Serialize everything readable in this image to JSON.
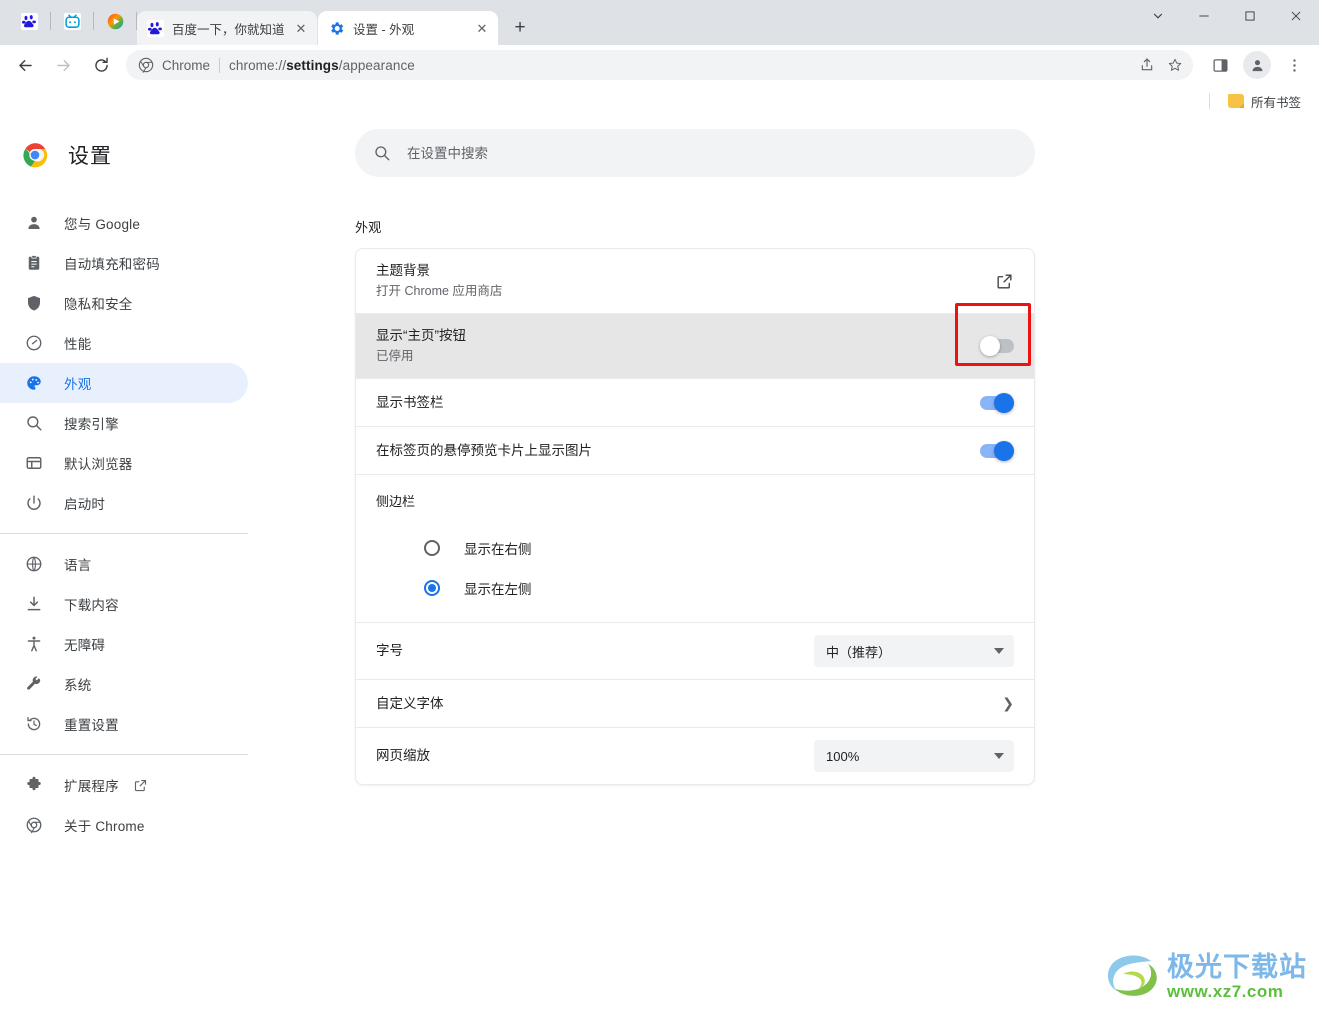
{
  "window": {
    "controls": [
      {
        "name": "tab-search-button",
        "glyph": "⌄"
      },
      {
        "name": "minimize-button",
        "glyph": "—"
      },
      {
        "name": "maximize-button",
        "glyph": "□"
      },
      {
        "name": "close-button",
        "glyph": "✕"
      }
    ]
  },
  "tabs": {
    "pinned": [
      {
        "name": "pinned-tab-baidu",
        "icon": "baidu-paw-icon"
      },
      {
        "name": "pinned-tab-bilibili",
        "icon": "bilibili-tv-icon"
      },
      {
        "name": "pinned-tab-video",
        "icon": "play-circle-icon"
      }
    ],
    "open": [
      {
        "title": "百度一下，你就知道",
        "icon": "baidu-paw-icon",
        "active": false
      },
      {
        "title": "设置 - 外观",
        "icon": "settings-gear-icon",
        "active": true
      }
    ],
    "new_tab_glyph": "+"
  },
  "toolbar": {
    "back_label": "←",
    "forward_label": "→",
    "reload_label": "⟳",
    "omnibox": {
      "scheme_label": "Chrome",
      "url_prefix": "chrome://",
      "url_bold": "settings",
      "url_suffix": "/appearance"
    },
    "share_name": "share-icon",
    "bookmark_name": "star-icon",
    "side_panel_name": "side-panel-icon",
    "profile_name": "avatar",
    "menu_name": "three-dot-menu-icon"
  },
  "bookmarks_bar": {
    "all_bookmarks_label": "所有书签"
  },
  "settings": {
    "brand_title": "设置",
    "sidebar": [
      {
        "label": "您与 Google",
        "icon": "person-icon",
        "active": false,
        "name": "sidebar-item-you-and-google"
      },
      {
        "label": "自动填充和密码",
        "icon": "clipboard-icon",
        "active": false,
        "name": "sidebar-item-autofill"
      },
      {
        "label": "隐私和安全",
        "icon": "shield-icon",
        "active": false,
        "name": "sidebar-item-privacy"
      },
      {
        "label": "性能",
        "icon": "speedometer-icon",
        "active": false,
        "name": "sidebar-item-performance"
      },
      {
        "label": "外观",
        "icon": "palette-icon",
        "active": true,
        "name": "sidebar-item-appearance"
      },
      {
        "label": "搜索引擎",
        "icon": "search-icon",
        "active": false,
        "name": "sidebar-item-search-engine"
      },
      {
        "label": "默认浏览器",
        "icon": "browser-window-icon",
        "active": false,
        "name": "sidebar-item-default-browser"
      },
      {
        "label": "启动时",
        "icon": "power-icon",
        "active": false,
        "name": "sidebar-item-on-startup"
      }
    ],
    "sidebar_group2": [
      {
        "label": "语言",
        "icon": "globe-icon",
        "name": "sidebar-item-languages"
      },
      {
        "label": "下载内容",
        "icon": "download-icon",
        "name": "sidebar-item-downloads"
      },
      {
        "label": "无障碍",
        "icon": "accessibility-icon",
        "name": "sidebar-item-accessibility"
      },
      {
        "label": "系统",
        "icon": "wrench-icon",
        "name": "sidebar-item-system"
      },
      {
        "label": "重置设置",
        "icon": "history-restore-icon",
        "name": "sidebar-item-reset-settings"
      }
    ],
    "sidebar_group3": [
      {
        "label": "扩展程序",
        "icon": "puzzle-icon",
        "external": true,
        "name": "sidebar-item-extensions"
      },
      {
        "label": "关于 Chrome",
        "icon": "chrome-icon",
        "external": false,
        "name": "sidebar-item-about-chrome"
      }
    ],
    "search_placeholder": "在设置中搜索",
    "search_value": "",
    "section_title": "外观",
    "rows": {
      "theme": {
        "title": "主题背景",
        "subtitle": "打开 Chrome 应用商店",
        "action_icon": "open-in-new-icon"
      },
      "home_button": {
        "title": "显示“主页”按钮",
        "subtitle": "已停用",
        "toggle_state": "off",
        "highlighted": true
      },
      "bookmarks_bar": {
        "title": "显示书签栏",
        "toggle_state": "on"
      },
      "tab_hover_images": {
        "title": "在标签页的悬停预览卡片上显示图片",
        "toggle_state": "on"
      },
      "side_panel": {
        "title": "侧边栏",
        "options": [
          {
            "label": "显示在右侧",
            "checked": false,
            "name": "radio-side-panel-right"
          },
          {
            "label": "显示在左侧",
            "checked": true,
            "name": "radio-side-panel-left"
          }
        ]
      },
      "font_size": {
        "title": "字号",
        "value": "中（推荐）"
      },
      "customize_fonts": {
        "title": "自定义字体",
        "chevron": "❯"
      },
      "page_zoom": {
        "title": "网页缩放",
        "value": "100%"
      }
    }
  },
  "watermark": {
    "main": "极光下载站",
    "sub": "www.xz7.com"
  },
  "colors": {
    "accent": "#1a73e8",
    "toggle_on_track": "#8ab4f8",
    "toggle_off_track": "#bdc1c6",
    "active_nav_bg": "#e8f0fe",
    "annotation": "#ee1111",
    "tabstrip_bg": "#dee1e6",
    "row_hover_bg": "#e6e6e6"
  }
}
